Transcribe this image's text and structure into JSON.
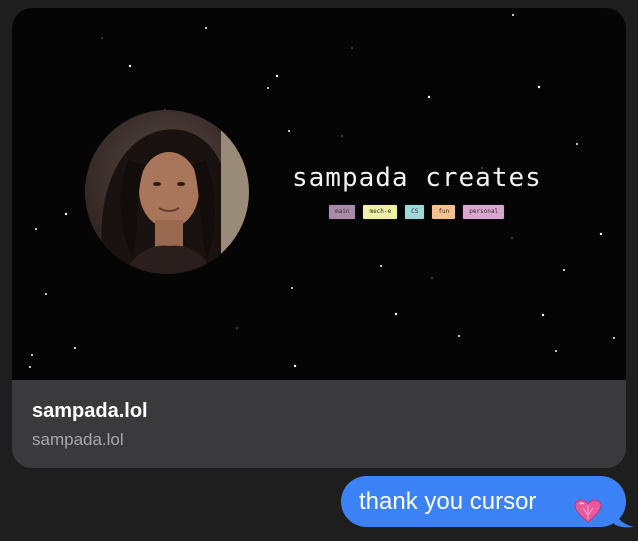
{
  "link_preview": {
    "site_title": "sampada creates",
    "tags": [
      {
        "label": "main",
        "color": "#a98aa8"
      },
      {
        "label": "mech-e",
        "color": "#eef0a8"
      },
      {
        "label": "CS",
        "color": "#9fd8d8"
      },
      {
        "label": "fun",
        "color": "#f4c28f"
      },
      {
        "label": "personal",
        "color": "#d9a6cf"
      }
    ],
    "title": "sampada.lol",
    "url": "sampada.lol"
  },
  "message": {
    "text": "thank you cursor",
    "emoji_icon": "pink-heart-icon",
    "bubble_color": "#3b82f6"
  }
}
